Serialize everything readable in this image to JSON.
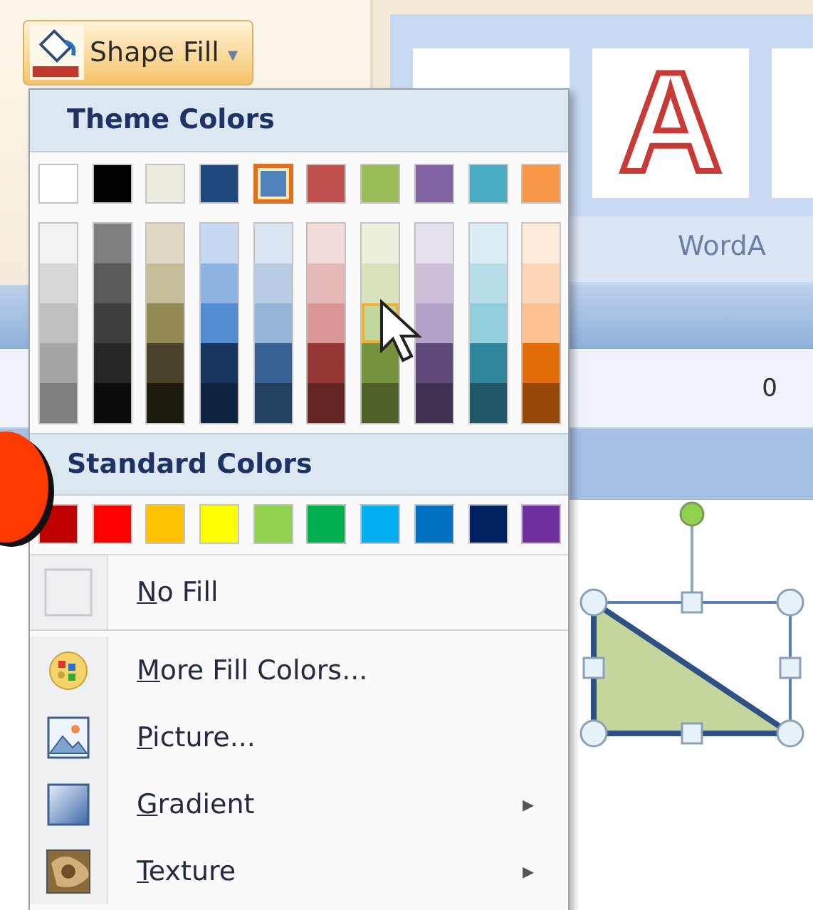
{
  "ribbon": {
    "shape_fill_button": {
      "label": "Shape Fill",
      "caret": "▾"
    },
    "wordart_gallery": {
      "tiles": [
        {
          "kind": "blank"
        },
        {
          "kind": "letter",
          "letter": "A"
        },
        {
          "kind": "blank"
        }
      ],
      "group_label": "WordA"
    },
    "ruler_label": "0"
  },
  "menu": {
    "theme_header": "Theme Colors",
    "theme_colors": [
      {
        "color": "#ffffff",
        "selected": false,
        "shades": [
          {
            "color": "#f2f2f2",
            "hovered": false
          },
          {
            "color": "#d8d8d8",
            "hovered": false
          },
          {
            "color": "#bfbfbf",
            "hovered": false
          },
          {
            "color": "#a5a5a5",
            "hovered": false
          },
          {
            "color": "#7f7f7f",
            "hovered": false
          }
        ]
      },
      {
        "color": "#000000",
        "selected": false,
        "shades": [
          {
            "color": "#7f7f7f",
            "hovered": false
          },
          {
            "color": "#595959",
            "hovered": false
          },
          {
            "color": "#3f3f3f",
            "hovered": false
          },
          {
            "color": "#262626",
            "hovered": false
          },
          {
            "color": "#0c0c0c",
            "hovered": false
          }
        ]
      },
      {
        "color": "#eeece1",
        "selected": false,
        "shades": [
          {
            "color": "#ddd9c3",
            "hovered": false
          },
          {
            "color": "#c4bd97",
            "hovered": false
          },
          {
            "color": "#938953",
            "hovered": false
          },
          {
            "color": "#494429",
            "hovered": false
          },
          {
            "color": "#1d1b10",
            "hovered": false
          }
        ]
      },
      {
        "color": "#1f497d",
        "selected": false,
        "shades": [
          {
            "color": "#c6d9f0",
            "hovered": false
          },
          {
            "color": "#8db3e2",
            "hovered": false
          },
          {
            "color": "#548dd4",
            "hovered": false
          },
          {
            "color": "#17365d",
            "hovered": false
          },
          {
            "color": "#0f243e",
            "hovered": false
          }
        ]
      },
      {
        "color": "#4f81bd",
        "selected": true,
        "shades": [
          {
            "color": "#dbe5f1",
            "hovered": false
          },
          {
            "color": "#b8cce4",
            "hovered": false
          },
          {
            "color": "#95b3d7",
            "hovered": false
          },
          {
            "color": "#366092",
            "hovered": false
          },
          {
            "color": "#244061",
            "hovered": false
          }
        ]
      },
      {
        "color": "#c0504d",
        "selected": false,
        "shades": [
          {
            "color": "#f2dcdb",
            "hovered": false
          },
          {
            "color": "#e5b9b7",
            "hovered": false
          },
          {
            "color": "#d99694",
            "hovered": false
          },
          {
            "color": "#953734",
            "hovered": false
          },
          {
            "color": "#632423",
            "hovered": false
          }
        ]
      },
      {
        "color": "#9bbb59",
        "selected": false,
        "shades": [
          {
            "color": "#ebf1dd",
            "hovered": false
          },
          {
            "color": "#d7e3bc",
            "hovered": false
          },
          {
            "color": "#c3d69b",
            "hovered": true
          },
          {
            "color": "#76923c",
            "hovered": false
          },
          {
            "color": "#4f6128",
            "hovered": false
          }
        ]
      },
      {
        "color": "#8064a2",
        "selected": false,
        "shades": [
          {
            "color": "#e5e0ec",
            "hovered": false
          },
          {
            "color": "#ccc1d9",
            "hovered": false
          },
          {
            "color": "#b2a2c7",
            "hovered": false
          },
          {
            "color": "#5f497a",
            "hovered": false
          },
          {
            "color": "#3f3151",
            "hovered": false
          }
        ]
      },
      {
        "color": "#4bacc6",
        "selected": false,
        "shades": [
          {
            "color": "#dbeef3",
            "hovered": false
          },
          {
            "color": "#b7dde8",
            "hovered": false
          },
          {
            "color": "#92cddc",
            "hovered": false
          },
          {
            "color": "#31859b",
            "hovered": false
          },
          {
            "color": "#205867",
            "hovered": false
          }
        ]
      },
      {
        "color": "#f79646",
        "selected": false,
        "shades": [
          {
            "color": "#fdeada",
            "hovered": false
          },
          {
            "color": "#fbd5b5",
            "hovered": false
          },
          {
            "color": "#fac08f",
            "hovered": false
          },
          {
            "color": "#e36c09",
            "hovered": false
          },
          {
            "color": "#974806",
            "hovered": false
          }
        ]
      }
    ],
    "standard_header": "Standard Colors",
    "standard_colors": [
      {
        "color": "#c00000"
      },
      {
        "color": "#ff0000"
      },
      {
        "color": "#ffc000"
      },
      {
        "color": "#ffff00"
      },
      {
        "color": "#92d050"
      },
      {
        "color": "#00b050"
      },
      {
        "color": "#00b0f0"
      },
      {
        "color": "#0070c0"
      },
      {
        "color": "#002060"
      },
      {
        "color": "#7030a0"
      }
    ],
    "items": [
      {
        "kind": "nofill",
        "label": "No Fill"
      },
      {
        "kind": "colors",
        "label": "More Fill Colors..."
      },
      {
        "kind": "picture",
        "label": "Picture..."
      },
      {
        "kind": "gradient",
        "label": "Gradient",
        "arrow": "▸"
      },
      {
        "kind": "texture",
        "label": "Texture",
        "arrow": "▸"
      }
    ]
  }
}
